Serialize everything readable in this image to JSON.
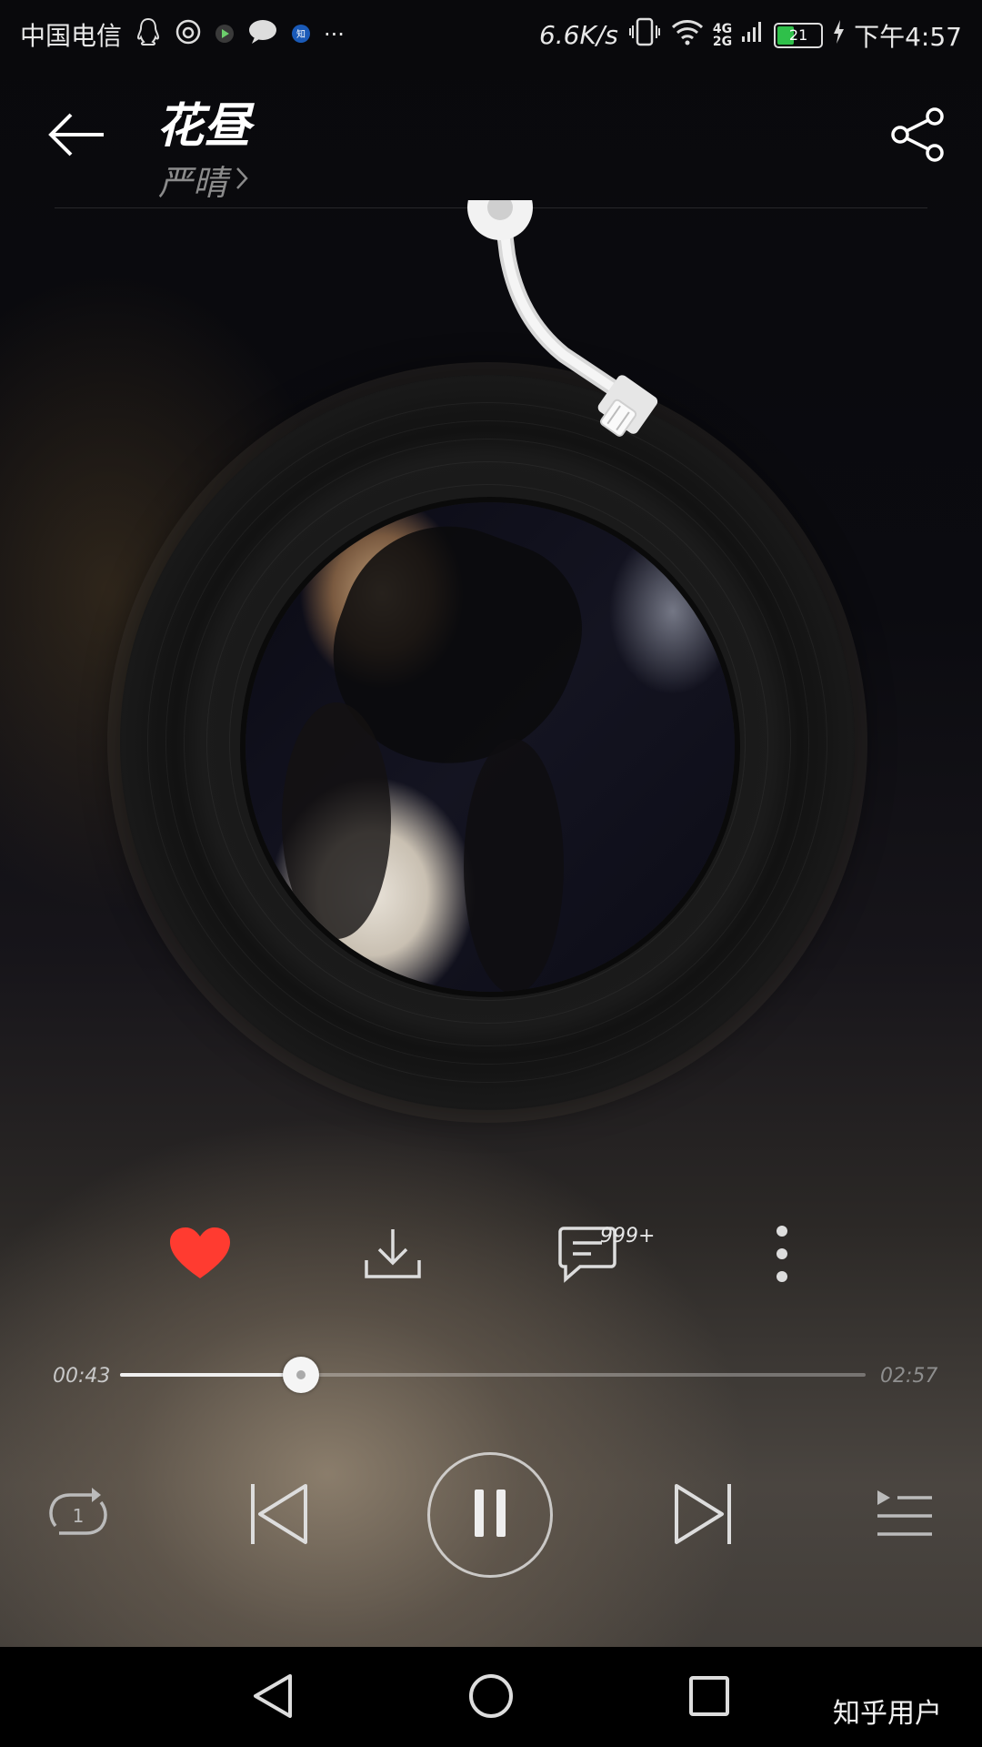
{
  "status_bar": {
    "carrier": "中国电信",
    "more": "···",
    "net_speed": "6.6K/s",
    "signal_primary": "4G",
    "signal_secondary": "2G",
    "battery": "21",
    "time": "下午4:57"
  },
  "header": {
    "title": "花昼",
    "artist": "严晴"
  },
  "actions": {
    "comment_count": "999+"
  },
  "progress": {
    "current": "00:43",
    "total": "02:57",
    "fraction": 0.243
  },
  "watermark": "知乎用户",
  "colors": {
    "like": "#ff3b30",
    "battery": "#2fc04a"
  },
  "icons": {
    "back": "arrow-left",
    "share": "share",
    "like": "heart",
    "download": "download",
    "comment": "comment",
    "more": "vertical-dots",
    "repeat": "repeat-one",
    "prev": "skip-previous",
    "play": "pause",
    "next": "skip-next",
    "playlist": "playlist"
  }
}
